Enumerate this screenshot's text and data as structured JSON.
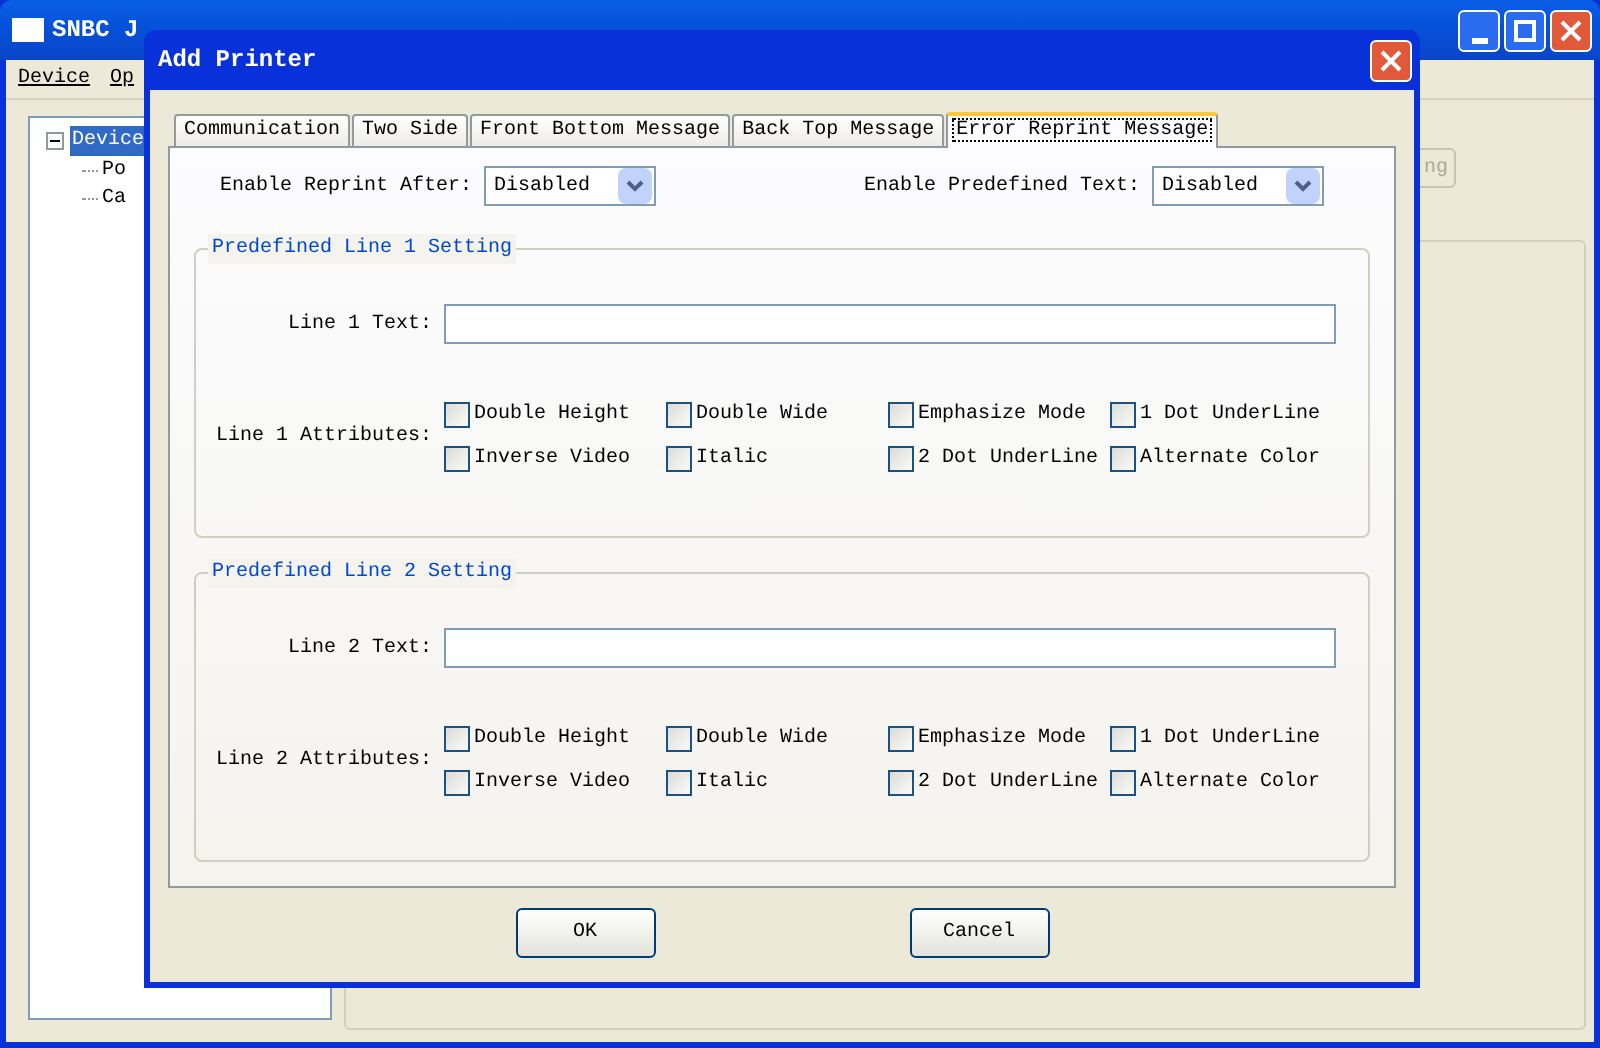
{
  "main_window": {
    "title": "SNBC J",
    "menu": [
      "Device",
      "Op"
    ],
    "tree": {
      "label": "Device",
      "selected": true,
      "expanded": true,
      "children": [
        {
          "label": "Po"
        },
        {
          "label": "Ca"
        }
      ]
    },
    "partial_button": "ng"
  },
  "dialog": {
    "title": "Add Printer",
    "tabs": [
      {
        "label": "Communication",
        "selected": false
      },
      {
        "label": "Two Side",
        "selected": false
      },
      {
        "label": "Front Bottom Message",
        "selected": false
      },
      {
        "label": "Back Top Message",
        "selected": false
      },
      {
        "label": "Error Reprint Message",
        "selected": true
      }
    ],
    "enable_reprint_after": {
      "label": "Enable Reprint After:",
      "value": "Disabled"
    },
    "enable_predefined_text": {
      "label": "Enable Predefined Text:",
      "value": "Disabled"
    },
    "groups": [
      {
        "title": "Predefined Line 1 Setting",
        "text_label": "Line 1 Text:",
        "attributes_label": "Line 1 Attributes:",
        "attributes": [
          {
            "label": "Double Height",
            "checked": false
          },
          {
            "label": "Double Wide",
            "checked": false
          },
          {
            "label": "Emphasize Mode",
            "checked": false
          },
          {
            "label": "1 Dot UnderLine",
            "checked": false
          },
          {
            "label": "Inverse Video",
            "checked": false
          },
          {
            "label": "Italic",
            "checked": false
          },
          {
            "label": "2 Dot UnderLine",
            "checked": false
          },
          {
            "label": "Alternate Color",
            "checked": false
          }
        ]
      },
      {
        "title": "Predefined Line 2 Setting",
        "text_label": "Line 2 Text:",
        "attributes_label": "Line 2 Attributes:",
        "attributes": [
          {
            "label": "Double Height",
            "checked": false
          },
          {
            "label": "Double Wide",
            "checked": false
          },
          {
            "label": "Emphasize Mode",
            "checked": false
          },
          {
            "label": "1 Dot UnderLine",
            "checked": false
          },
          {
            "label": "Inverse Video",
            "checked": false
          },
          {
            "label": "Italic",
            "checked": false
          },
          {
            "label": "2 Dot UnderLine",
            "checked": false
          },
          {
            "label": "Alternate Color",
            "checked": false
          }
        ]
      }
    ],
    "buttons": [
      "OK",
      "Cancel"
    ]
  }
}
